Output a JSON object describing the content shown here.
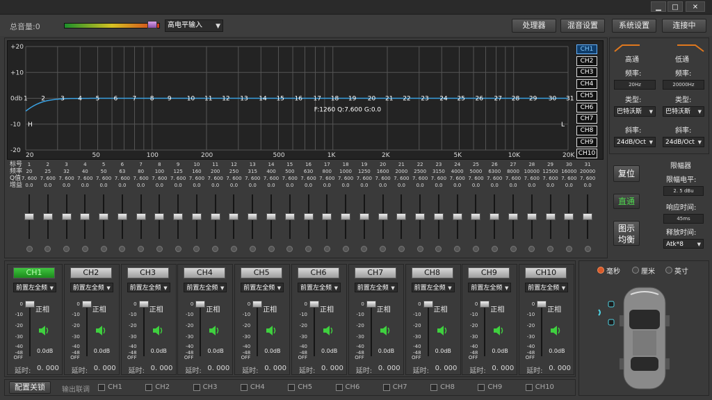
{
  "window": {
    "minimize": "▁",
    "maximize": "□",
    "close": "✕"
  },
  "toolbar": {
    "master_volume": "总音量:0",
    "input_select": "高电平输入",
    "buttons": [
      "处理器",
      "混音设置",
      "系统设置",
      "连接中"
    ]
  },
  "graph": {
    "y_ticks": [
      "+20",
      "+10",
      "0db",
      "-10",
      "-20"
    ],
    "x_ticks": [
      "20",
      "50",
      "100",
      "200",
      "500",
      "1K",
      "2K",
      "5K",
      "10K",
      "20K"
    ],
    "band_markers": [
      "1",
      "2",
      "3",
      "4",
      "5",
      "6",
      "7",
      "8",
      "9",
      "10",
      "11",
      "12",
      "13",
      "14",
      "15",
      "16",
      "17",
      "18",
      "19",
      "20",
      "21",
      "22",
      "23",
      "24",
      "25",
      "26",
      "27",
      "28",
      "29",
      "30",
      "31"
    ],
    "readout": "F:1260 Q:7.600 G:0.0",
    "hp_marker": "H",
    "lp_marker": "L",
    "channels": [
      "CH1",
      "CH2",
      "CH3",
      "CH4",
      "CH5",
      "CH6",
      "CH7",
      "CH8",
      "CH9",
      "CH10"
    ],
    "selected_channel": "CH1",
    "curve_color": "#3aa0e0"
  },
  "eq": {
    "row_labels": [
      "标号",
      "频率",
      "Q值",
      "增益"
    ],
    "bands": [
      {
        "n": "1",
        "f": "20",
        "q": "7. 600",
        "g": "0.0"
      },
      {
        "n": "2",
        "f": "25",
        "q": "7. 600",
        "g": "0.0"
      },
      {
        "n": "3",
        "f": "32",
        "q": "7. 600",
        "g": "0.0"
      },
      {
        "n": "4",
        "f": "40",
        "q": "7. 600",
        "g": "0.0"
      },
      {
        "n": "5",
        "f": "50",
        "q": "7. 600",
        "g": "0.0"
      },
      {
        "n": "6",
        "f": "63",
        "q": "7. 600",
        "g": "0.0"
      },
      {
        "n": "7",
        "f": "80",
        "q": "7. 600",
        "g": "0.0"
      },
      {
        "n": "8",
        "f": "100",
        "q": "7. 600",
        "g": "0.0"
      },
      {
        "n": "9",
        "f": "125",
        "q": "7. 600",
        "g": "0.0"
      },
      {
        "n": "10",
        "f": "160",
        "q": "7. 600",
        "g": "0.0"
      },
      {
        "n": "11",
        "f": "200",
        "q": "7. 600",
        "g": "0.0"
      },
      {
        "n": "12",
        "f": "250",
        "q": "7. 600",
        "g": "0.0"
      },
      {
        "n": "13",
        "f": "315",
        "q": "7. 600",
        "g": "0.0"
      },
      {
        "n": "14",
        "f": "400",
        "q": "7. 600",
        "g": "0.0"
      },
      {
        "n": "15",
        "f": "500",
        "q": "7. 600",
        "g": "0.0"
      },
      {
        "n": "16",
        "f": "630",
        "q": "7. 600",
        "g": "0.0"
      },
      {
        "n": "17",
        "f": "800",
        "q": "7. 600",
        "g": "0.0"
      },
      {
        "n": "18",
        "f": "1000",
        "q": "7. 600",
        "g": "0.0"
      },
      {
        "n": "19",
        "f": "1250",
        "q": "7. 600",
        "g": "0.0"
      },
      {
        "n": "20",
        "f": "1600",
        "q": "7. 600",
        "g": "0.0"
      },
      {
        "n": "21",
        "f": "2000",
        "q": "7. 600",
        "g": "0.0"
      },
      {
        "n": "22",
        "f": "2500",
        "q": "7. 600",
        "g": "0.0"
      },
      {
        "n": "23",
        "f": "3150",
        "q": "7. 600",
        "g": "0.0"
      },
      {
        "n": "24",
        "f": "4000",
        "q": "7. 600",
        "g": "0.0"
      },
      {
        "n": "25",
        "f": "5000",
        "q": "7. 600",
        "g": "0.0"
      },
      {
        "n": "26",
        "f": "6300",
        "q": "7. 600",
        "g": "0.0"
      },
      {
        "n": "27",
        "f": "8000",
        "q": "7. 600",
        "g": "0.0"
      },
      {
        "n": "28",
        "f": "10000",
        "q": "7. 600",
        "g": "0.0"
      },
      {
        "n": "29",
        "f": "12500",
        "q": "7. 600",
        "g": "0.0"
      },
      {
        "n": "30",
        "f": "16000",
        "q": "7. 600",
        "g": "0.0"
      },
      {
        "n": "31",
        "f": "20000",
        "q": "7. 600",
        "g": "0.0"
      }
    ],
    "reset": "复位",
    "bypass": "直通",
    "graphic_eq": "图示\n均衡"
  },
  "crossover": {
    "highpass": {
      "title": "高通",
      "freq_label": "频率:",
      "freq": "20Hz",
      "type_label": "类型:",
      "type": "巴特沃斯",
      "slope_label": "斜率:",
      "slope": "24dB/Oct"
    },
    "lowpass": {
      "title": "低通",
      "freq_label": "频率:",
      "freq": "20000Hz",
      "type_label": "类型:",
      "type": "巴特沃斯",
      "slope_label": "斜率:",
      "slope": "24dB/Oct"
    }
  },
  "limiter": {
    "title": "限幅器",
    "level_label": "限幅电平:",
    "level": "2. 5 dBu",
    "response_label": "响应时间:",
    "response": "45ms",
    "release_label": "释放时间:",
    "release": "Atk*8"
  },
  "channels": [
    {
      "name": "CH1",
      "source": "前置左全频",
      "phase": "正相",
      "gain": "0.0dB",
      "delay_label": "延时:",
      "delay": "0. 000"
    },
    {
      "name": "CH2",
      "source": "前置左全频",
      "phase": "正相",
      "gain": "0.0dB",
      "delay_label": "延时:",
      "delay": "0. 000"
    },
    {
      "name": "CH3",
      "source": "前置左全频",
      "phase": "正相",
      "gain": "0.0dB",
      "delay_label": "延时:",
      "delay": "0. 000"
    },
    {
      "name": "CH4",
      "source": "前置左全频",
      "phase": "正相",
      "gain": "0.0dB",
      "delay_label": "延时:",
      "delay": "0. 000"
    },
    {
      "name": "CH5",
      "source": "前置左全频",
      "phase": "正相",
      "gain": "0.0dB",
      "delay_label": "延时:",
      "delay": "0. 000"
    },
    {
      "name": "CH6",
      "source": "前置左全频",
      "phase": "正相",
      "gain": "0.0dB",
      "delay_label": "延时:",
      "delay": "0. 000"
    },
    {
      "name": "CH7",
      "source": "前置左全频",
      "phase": "正相",
      "gain": "0.0dB",
      "delay_label": "延时:",
      "delay": "0. 000"
    },
    {
      "name": "CH8",
      "source": "前置左全频",
      "phase": "正相",
      "gain": "0.0dB",
      "delay_label": "延时:",
      "delay": "0. 000"
    },
    {
      "name": "CH9",
      "source": "前置左全频",
      "phase": "正相",
      "gain": "0.0dB",
      "delay_label": "延时:",
      "delay": "0. 000"
    },
    {
      "name": "CH10",
      "source": "前置左全频",
      "phase": "正相",
      "gain": "0.0dB",
      "delay_label": "延时:",
      "delay": "0. 000"
    }
  ],
  "fader_scale": [
    "0",
    "-10",
    "-20",
    "-30",
    "-40",
    "-48",
    "OFF"
  ],
  "units": {
    "options": [
      "毫秒",
      "厘米",
      "英寸"
    ],
    "selected": "毫秒"
  },
  "footer": {
    "lock": "配置关锁",
    "link_label": "输出联调",
    "link_channels": [
      "CH1",
      "CH2",
      "CH3",
      "CH4",
      "CH5",
      "CH6",
      "CH7",
      "CH8",
      "CH9",
      "CH10"
    ]
  },
  "colors": {
    "accent_orange": "#e0781e",
    "active_green": "#2aa62a",
    "speaker_icon": "#3fd03f"
  }
}
